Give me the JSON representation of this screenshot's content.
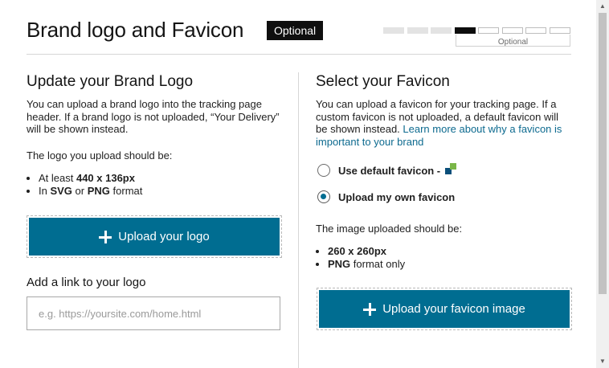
{
  "header": {
    "title": "Brand logo and Favicon",
    "badge": "Optional",
    "progress": {
      "total_steps": 8,
      "current_step": 4,
      "optional_label": "Optional"
    }
  },
  "logo_section": {
    "heading": "Update your Brand Logo",
    "description": "You can upload a brand logo into the tracking page header. If a brand logo is not uploaded, “Your Delivery” will be shown instead.",
    "requirements_intro": "The logo you upload should be:",
    "req1_prefix": "At least ",
    "req1_bold": "440 x 136px",
    "req2_prefix": "In ",
    "req2_bold1": "SVG",
    "req2_mid": " or ",
    "req2_bold2": "PNG",
    "req2_suffix": " format",
    "upload_button": "Upload your logo",
    "link_heading": "Add a link to your logo",
    "link_placeholder": "e.g. https://yoursite.com/home.html",
    "link_value": ""
  },
  "favicon_section": {
    "heading": "Select your Favicon",
    "description": "You can upload a favicon for your tracking page. If a custom favicon is not uploaded, a default favicon will be shown instead. ",
    "learn_more_link": "Learn more about why a favicon is important to your brand",
    "option_default": "Use default favicon -",
    "option_own": "Upload my own favicon",
    "selected_option": "own",
    "requirements_intro": "The image uploaded should be:",
    "req1_bold": "260 x 260px",
    "req2_bold": "PNG",
    "req2_suffix": " format only",
    "upload_button": "Upload your favicon image"
  },
  "icons": {
    "plus": "plus-icon",
    "default_favicon": "default-favicon-icon",
    "scroll_up": "scroll-up-arrow-icon",
    "scroll_down": "scroll-down-arrow-icon"
  },
  "colors": {
    "primary_button": "#006d91",
    "link": "#0d6a8f",
    "badge_bg": "#0f0f0f",
    "favicon_blue": "#0a4f7a",
    "favicon_green": "#7ab648"
  }
}
